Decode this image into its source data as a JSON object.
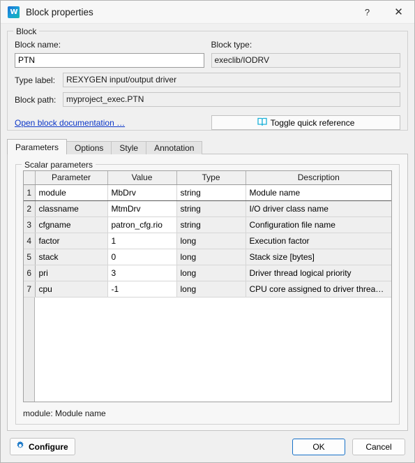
{
  "window": {
    "title": "Block properties",
    "app_icon": "rexygen-logo-icon",
    "help_label": "?",
    "close_label": "✕"
  },
  "block_group": {
    "legend": "Block",
    "block_name_label": "Block name:",
    "block_name_value": "PTN",
    "block_type_label": "Block type:",
    "block_type_value": "execlib/IODRV",
    "type_label_label": "Type label:",
    "type_label_value": "REXYGEN input/output driver",
    "block_path_label": "Block path:",
    "block_path_value": "myproject_exec.PTN",
    "doc_link": "Open block documentation …",
    "toggle_quick_reference": "Toggle quick reference",
    "book_icon": "open-book-icon"
  },
  "tabs": [
    {
      "label": "Parameters",
      "active": true
    },
    {
      "label": "Options",
      "active": false
    },
    {
      "label": "Style",
      "active": false
    },
    {
      "label": "Annotation",
      "active": false
    }
  ],
  "scalar_parameters": {
    "legend": "Scalar parameters",
    "columns": [
      "",
      "Parameter",
      "Value",
      "Type",
      "Description"
    ],
    "rows": [
      {
        "n": "1",
        "parameter": "module",
        "value": "MbDrv",
        "type": "string",
        "description": "Module name",
        "selected": true
      },
      {
        "n": "2",
        "parameter": "classname",
        "value": "MtmDrv",
        "type": "string",
        "description": "I/O driver class name",
        "selected": false
      },
      {
        "n": "3",
        "parameter": "cfgname",
        "value": "patron_cfg.rio",
        "type": "string",
        "description": "Configuration file name",
        "selected": false
      },
      {
        "n": "4",
        "parameter": "factor",
        "value": "1",
        "type": "long",
        "description": "Execution factor",
        "selected": false
      },
      {
        "n": "5",
        "parameter": "stack",
        "value": "0",
        "type": "long",
        "description": "Stack size [bytes]",
        "selected": false
      },
      {
        "n": "6",
        "parameter": "pri",
        "value": "3",
        "type": "long",
        "description": "Driver thread logical priority",
        "selected": false
      },
      {
        "n": "7",
        "parameter": "cpu",
        "value": "-1",
        "type": "long",
        "description": "CPU core assigned to driver thread …",
        "selected": false
      }
    ]
  },
  "status_line": "module: Module name",
  "footer": {
    "configure_label": "Configure",
    "configure_icon": "gear-icon",
    "ok_label": "OK",
    "cancel_label": "Cancel"
  },
  "colors": {
    "link": "#0b36c8",
    "accent": "#1671c8",
    "book_icon": "#19b0d8",
    "gear_icon": "#1b79c8",
    "window_bg": "#f0f0f0",
    "panel_bg": "#f7f7f7"
  }
}
